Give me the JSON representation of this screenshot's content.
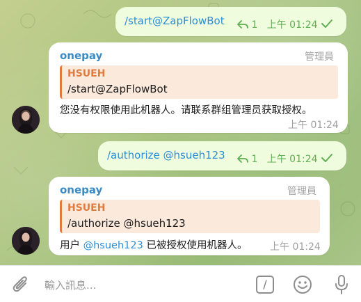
{
  "messages": [
    {
      "type": "outgoing",
      "text": "/start@ZapFlowBot",
      "reply_count": "1",
      "time": "上午 01:24"
    },
    {
      "type": "incoming",
      "sender": "onepay",
      "role": "管理員",
      "quote": {
        "name": "HSUEH",
        "text": "/start@ZapFlowBot"
      },
      "text": "您没有权限使用此机器人。请联系群组管理员获取授权。",
      "time": "上午 01:24"
    },
    {
      "type": "outgoing",
      "text": "/authorize @hsueh123",
      "reply_count": "1",
      "time": "上午 01:24"
    },
    {
      "type": "incoming",
      "sender": "onepay",
      "role": "管理員",
      "quote": {
        "name": "HSUEH",
        "text": "/authorize @hsueh123"
      },
      "text_before": "用户",
      "mention": "@hsueh123",
      "text_after": "已被授权使用机器人。",
      "time": "上午 01:24"
    }
  ],
  "composer": {
    "placeholder": "輸入訊息...",
    "command_glyph": "/",
    "icons": [
      "paperclip-icon",
      "slash-command-icon",
      "emoji-icon",
      "microphone-icon"
    ]
  },
  "colors": {
    "outgoing_bubble": "#effdde",
    "incoming_bubble": "#ffffff",
    "sender_name": "#3a8bc4",
    "quote_accent": "#e07c3f",
    "link": "#2c8ed6",
    "read_check": "#5fae53"
  }
}
